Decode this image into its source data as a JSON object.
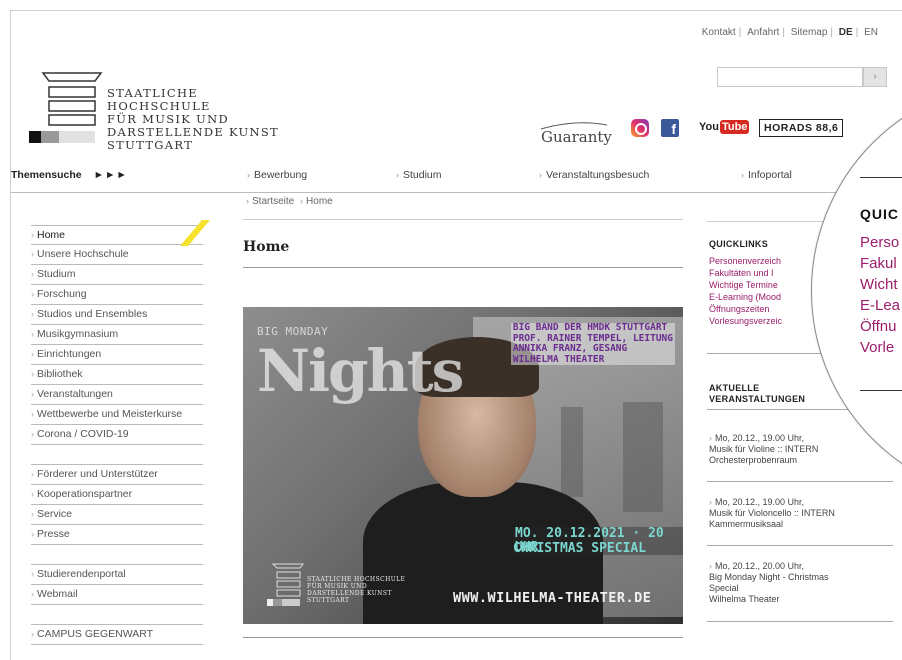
{
  "toplinks": {
    "kontakt": "Kontakt",
    "anfahrt": "Anfahrt",
    "sitemap": "Sitemap",
    "de": "DE",
    "en": "EN"
  },
  "search": {
    "button": "›"
  },
  "logo": {
    "line1": "STAATLICHE HOCHSCHULE",
    "line2": "FÜR MUSIK UND",
    "line3": "DARSTELLENDE KUNST",
    "line4": "STUTTGART"
  },
  "partners": {
    "guaranty": "Guaranty",
    "youtube_you": "You",
    "youtube_tube": "Tube",
    "horads": "HORADS 88,6"
  },
  "nav": {
    "themensuche": "Themensuche",
    "arrows": "►►►",
    "items": [
      "Bewerbung",
      "Studium",
      "Veranstaltungsbesuch",
      "Infoportal"
    ]
  },
  "breadcrumb": {
    "startseite": "Startseite",
    "home": "Home"
  },
  "sidebar": {
    "group1": [
      "Home",
      "Unsere Hochschule",
      "Studium",
      "Forschung",
      "Studios und Ensembles",
      "Musikgymnasium",
      "Einrichtungen",
      "Bibliothek",
      "Veranstaltungen",
      "Wettbewerbe und Meisterkurse",
      "Corona / COVID-19"
    ],
    "group2": [
      "Förderer und Unterstützer",
      "Kooperationspartner",
      "Service",
      "Presse"
    ],
    "group3": [
      "Studierendenportal",
      "Webmail"
    ],
    "group4": [
      "CAMPUS GEGENWART"
    ]
  },
  "main": {
    "title": "Home"
  },
  "banner": {
    "big_monday": "BIG MONDAY",
    "nights": "Nights",
    "info": [
      "BIG BAND DER HMDK STUTTGART",
      "PROF. RAINER TEMPEL, LEITUNG",
      "ANNIKA FRANZ, GESANG",
      "WILHELMA THEATER"
    ],
    "date": "MO. 20.12.2021 · 20 UHR",
    "special": "CHRISTMAS SPECIAL",
    "url": "WWW.WILHELMA-THEATER.DE",
    "logo_lines": [
      "STAATLICHE HOCHSCHULE",
      "FÜR MUSIK UND",
      "DARSTELLENDE KUNST",
      "STUTTGART"
    ]
  },
  "quicklinks": {
    "title": "QUICKLINKS",
    "items": [
      "Personenverzeich",
      "Fakultäten und I",
      "Wichtige Termine",
      "E-Learning (Mood",
      "Öffnungszeiten",
      "Vorlesungsverzeic"
    ]
  },
  "events": {
    "title_line1": "AKTUELLE",
    "title_line2": "VERANSTALTUNGEN",
    "items": [
      {
        "line1": "Mo,  20.12., 19.00 Uhr,",
        "line2": "Musik für Violine :: INTERN",
        "line3": "Orchesterprobenraum"
      },
      {
        "line1": "Mo,  20.12., 19.00 Uhr,",
        "line2": "Musik für Violoncello :: INTERN",
        "line3": "Kammermusiksaal"
      },
      {
        "line1": "Mo,  20.12., 20.00 Uhr,",
        "line2": "Big Monday Night - Christmas",
        "line3": "Special",
        "line4": "Wilhelma Theater"
      }
    ]
  },
  "magnifier": {
    "title": "QUIC",
    "items": [
      "Perso",
      "Fakul",
      "Wicht",
      "E-Lea",
      "Öffnu",
      "Vorle"
    ]
  },
  "colors": {
    "accent_link": "#9b1d6b",
    "home_marker": "#f5e22d"
  }
}
